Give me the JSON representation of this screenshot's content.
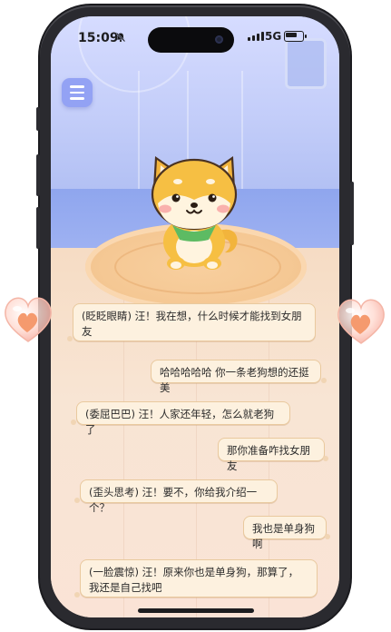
{
  "status_bar": {
    "time": "15:09",
    "mute_icon": "bell-slash-icon",
    "network": "5G",
    "battery_icon": "battery-icon"
  },
  "header": {
    "menu_icon": "hamburger-menu-icon"
  },
  "pet": {
    "icon": "shiba-dog-icon"
  },
  "chat": {
    "messages": [
      {
        "side": "left",
        "text": "(眨眨眼睛) 汪！我在想，什么时候才能找到女朋友"
      },
      {
        "side": "right",
        "text": "哈哈哈哈哈 你一条老狗想的还挺美"
      },
      {
        "side": "left",
        "text": "(委屈巴巴) 汪！人家还年轻，怎么就老狗了"
      },
      {
        "side": "right",
        "text": "那你准备咋找女朋友"
      },
      {
        "side": "left",
        "text": "(歪头思考) 汪！要不，你给我介绍一个？"
      },
      {
        "side": "right",
        "text": "我也是单身狗啊"
      },
      {
        "side": "left",
        "text": "(一脸震惊) 汪！原来你也是单身狗，那算了，我还是自己找吧"
      }
    ]
  },
  "decorations": {
    "left_heart_icon": "heart-icon",
    "right_heart_icon": "heart-icon"
  },
  "colors": {
    "menu_button": "#93a2f4",
    "bubble_bg": "#fdf1df",
    "bubble_border": "#e9c99e",
    "rug": "#f5c894"
  }
}
